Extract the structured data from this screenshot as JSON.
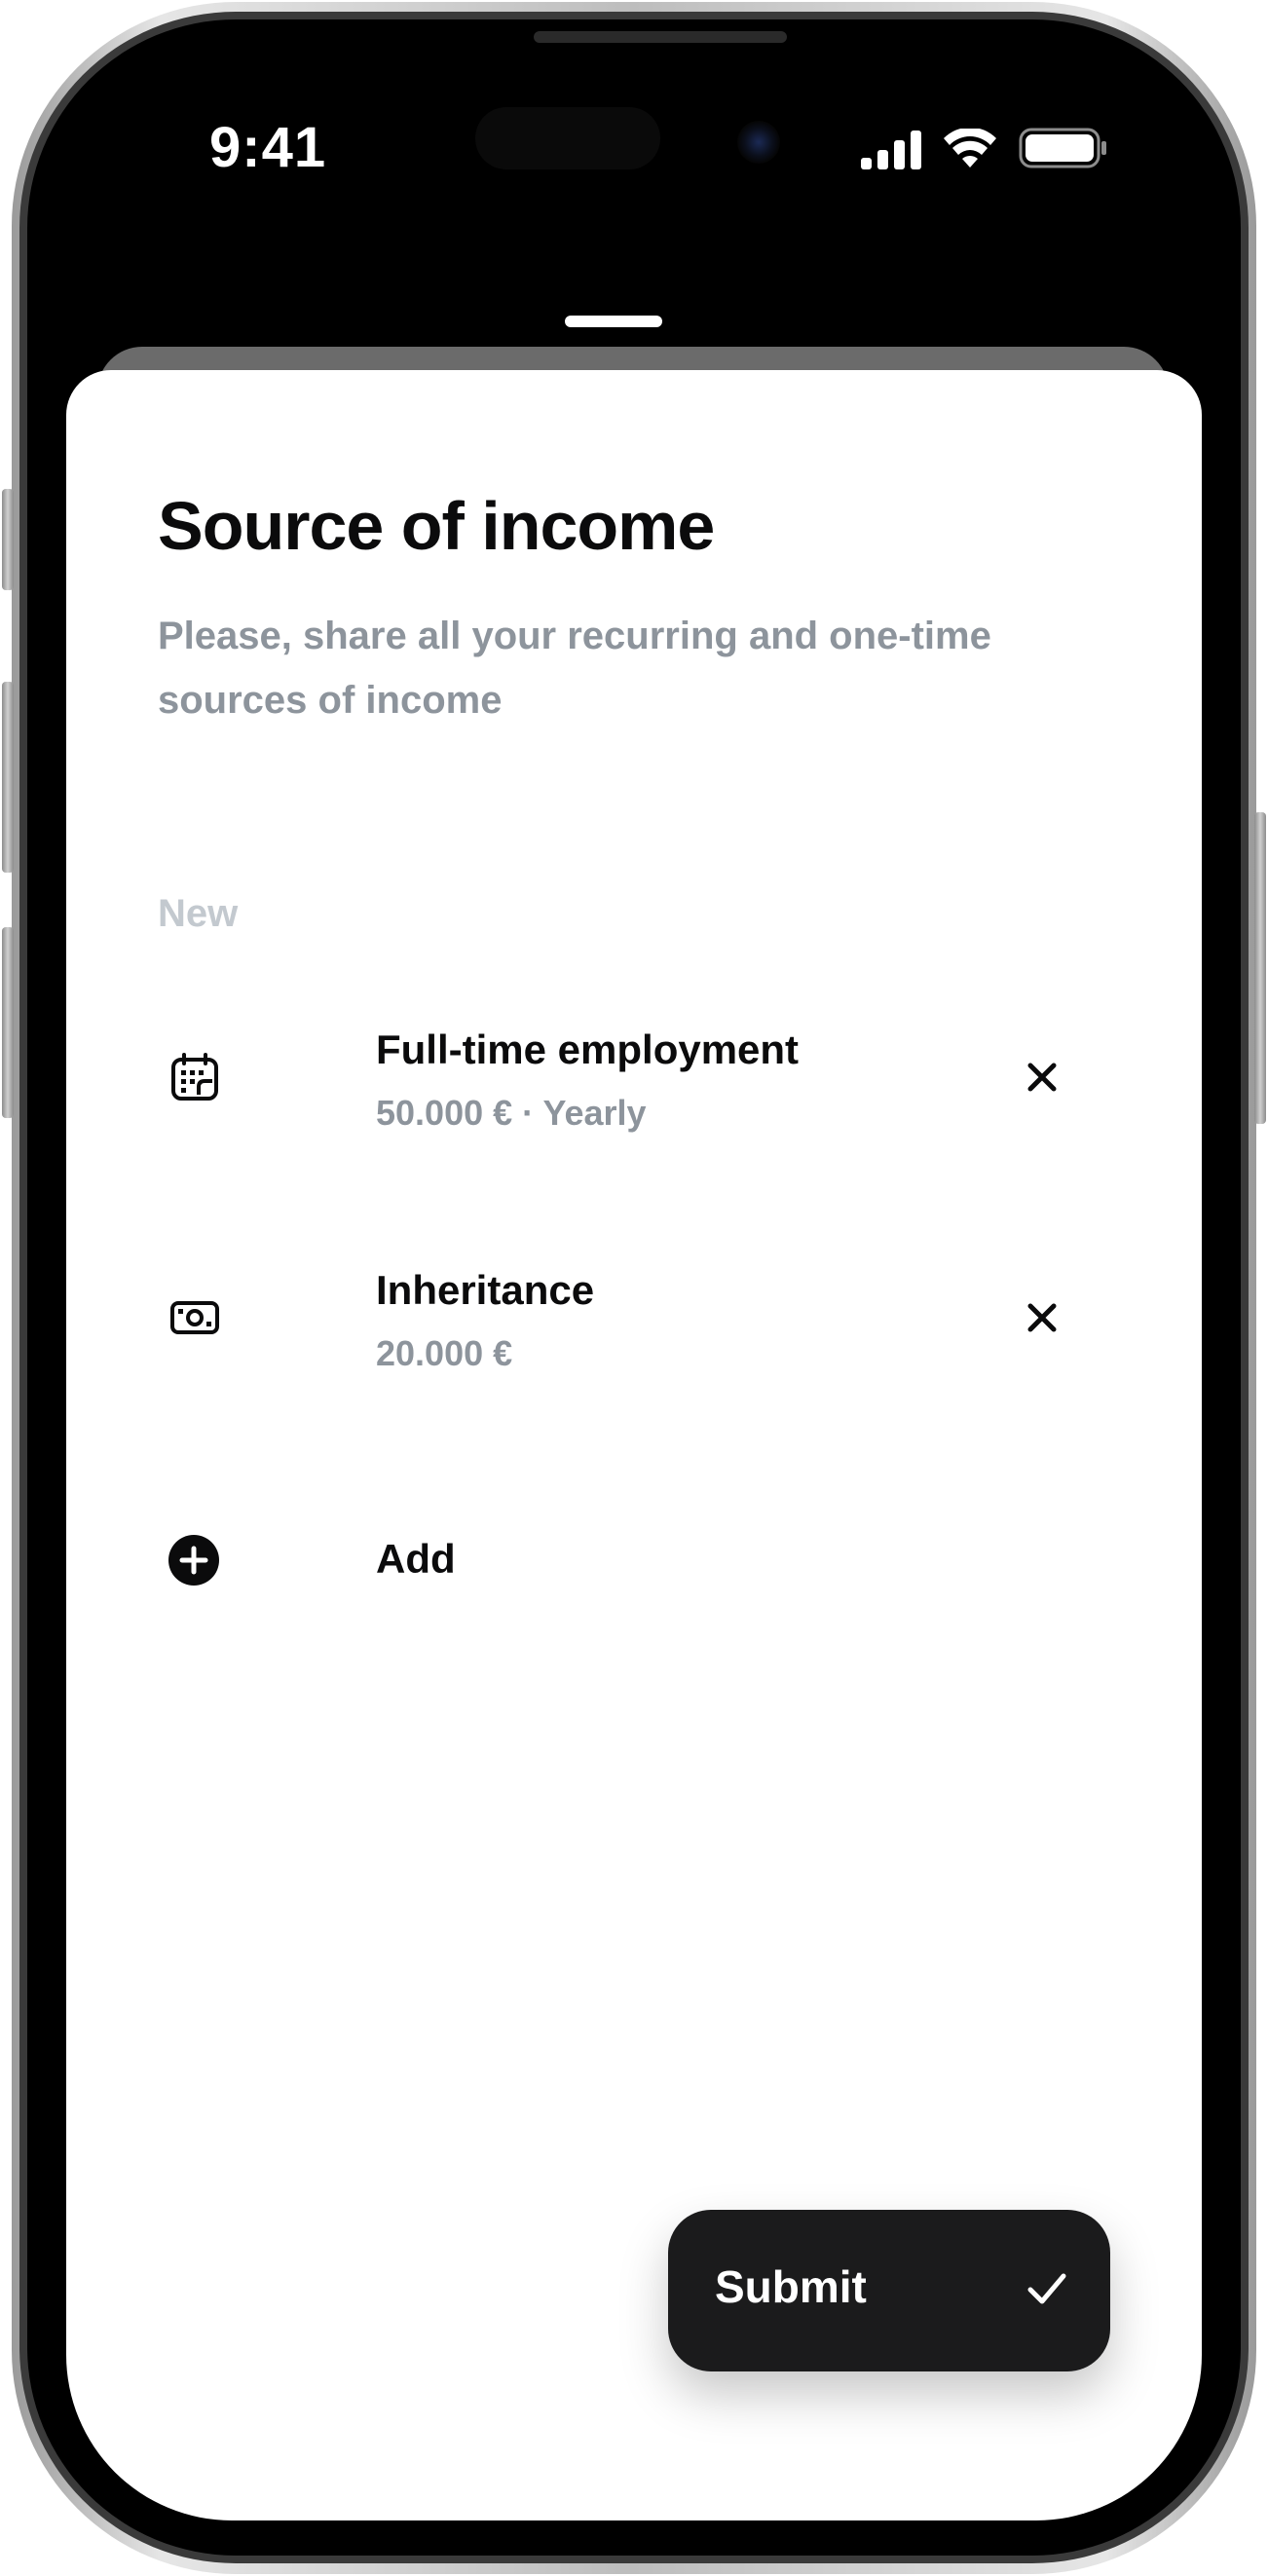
{
  "status_bar": {
    "time": "9:41",
    "signal_icon": "cellular-signal-icon",
    "wifi_icon": "wifi-icon",
    "battery_icon": "battery-icon"
  },
  "page": {
    "title": "Source of income",
    "subtitle": "Please, share all your recurring and one-time sources of income"
  },
  "section": {
    "label": "New"
  },
  "income_items": [
    {
      "title": "Full-time employment",
      "subtitle": "50.000 € · Yearly",
      "icon": "calendar-icon"
    },
    {
      "title": "Inheritance",
      "subtitle": "20.000 €",
      "icon": "banknote-icon"
    }
  ],
  "add": {
    "label": "Add",
    "icon": "plus-circle-icon"
  },
  "submit": {
    "label": "Submit",
    "icon": "checkmark-icon"
  },
  "colors": {
    "primary_text": "#0b0b0c",
    "secondary_text": "#8d949c",
    "section_label": "#c3c9cf",
    "button_bg": "#1b1b1c",
    "sheet_bg": "#ffffff"
  }
}
